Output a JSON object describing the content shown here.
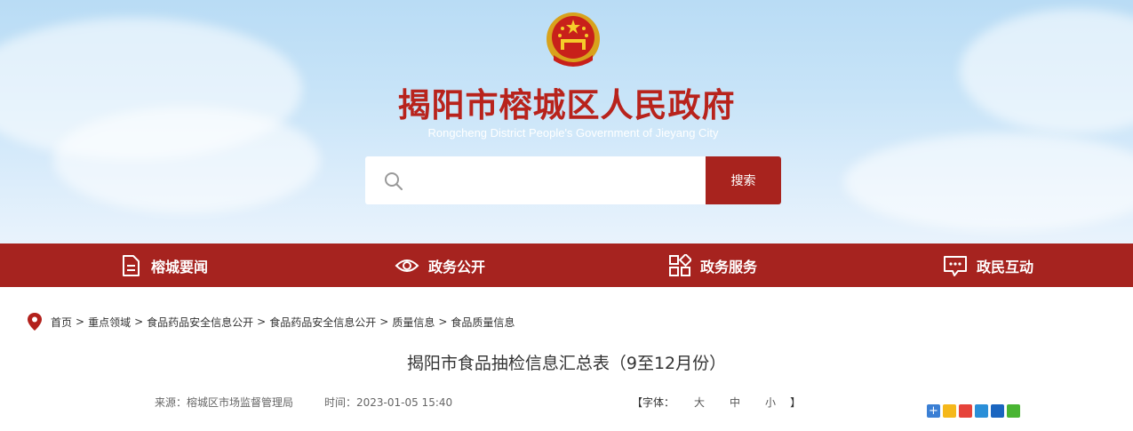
{
  "header": {
    "title": "揭阳市榕城区人民政府",
    "subtitle": "Rongcheng District People's Government of Jieyang City",
    "emblem_icon": "national-emblem-icon"
  },
  "search": {
    "placeholder": "",
    "button_label": "搜索",
    "icon": "search-icon"
  },
  "nav": {
    "items": [
      {
        "label": "榕城要闻",
        "icon": "document-icon"
      },
      {
        "label": "政务公开",
        "icon": "eye-icon"
      },
      {
        "label": "政务服务",
        "icon": "grid-icon"
      },
      {
        "label": "政民互动",
        "icon": "chat-icon"
      }
    ]
  },
  "breadcrumb": {
    "icon": "location-pin-icon",
    "items": [
      "首页",
      "重点领域",
      "食品药品安全信息公开",
      "食品药品安全信息公开",
      "质量信息",
      "食品质量信息"
    ],
    "separator": ">"
  },
  "article": {
    "title": "揭阳市食品抽检信息汇总表（9至12月份）",
    "source": "来源：榕城区市场监督管理局",
    "time": "时间：2023-01-05 15:40",
    "font_label": "【字体：",
    "font_options": [
      "大",
      "中",
      "小"
    ],
    "font_close": "】"
  },
  "share": {
    "icons": [
      "share-more-icon",
      "qzone-icon",
      "weibo-icon",
      "tencent-weibo-icon",
      "renren-icon",
      "wechat-icon"
    ]
  },
  "colors": {
    "brand_red": "#a6231f",
    "title_red": "#b8231c",
    "sky_blue": "#c8e4f8"
  }
}
